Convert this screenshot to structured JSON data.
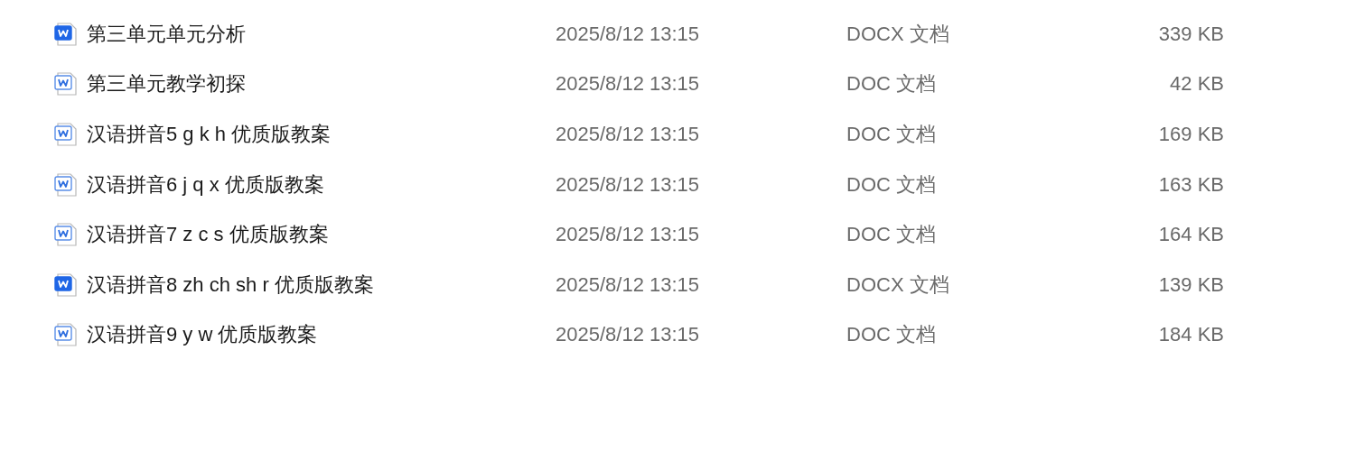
{
  "files": [
    {
      "name": "第三单元单元分析",
      "modified": "2025/8/12 13:15",
      "type": "DOCX 文档",
      "size": "339 KB",
      "kind": "docx"
    },
    {
      "name": "第三单元教学初探",
      "modified": "2025/8/12 13:15",
      "type": "DOC 文档",
      "size": "42 KB",
      "kind": "doc"
    },
    {
      "name": "汉语拼音5 g k h 优质版教案",
      "modified": "2025/8/12 13:15",
      "type": "DOC 文档",
      "size": "169 KB",
      "kind": "doc"
    },
    {
      "name": "汉语拼音6 j q x 优质版教案",
      "modified": "2025/8/12 13:15",
      "type": "DOC 文档",
      "size": "163 KB",
      "kind": "doc"
    },
    {
      "name": "汉语拼音7 z c s 优质版教案",
      "modified": "2025/8/12 13:15",
      "type": "DOC 文档",
      "size": "164 KB",
      "kind": "doc"
    },
    {
      "name": "汉语拼音8 zh ch sh r 优质版教案",
      "modified": "2025/8/12 13:15",
      "type": "DOCX 文档",
      "size": "139 KB",
      "kind": "docx"
    },
    {
      "name": "汉语拼音9 y w 优质版教案",
      "modified": "2025/8/12 13:15",
      "type": "DOC 文档",
      "size": "184 KB",
      "kind": "doc"
    }
  ]
}
